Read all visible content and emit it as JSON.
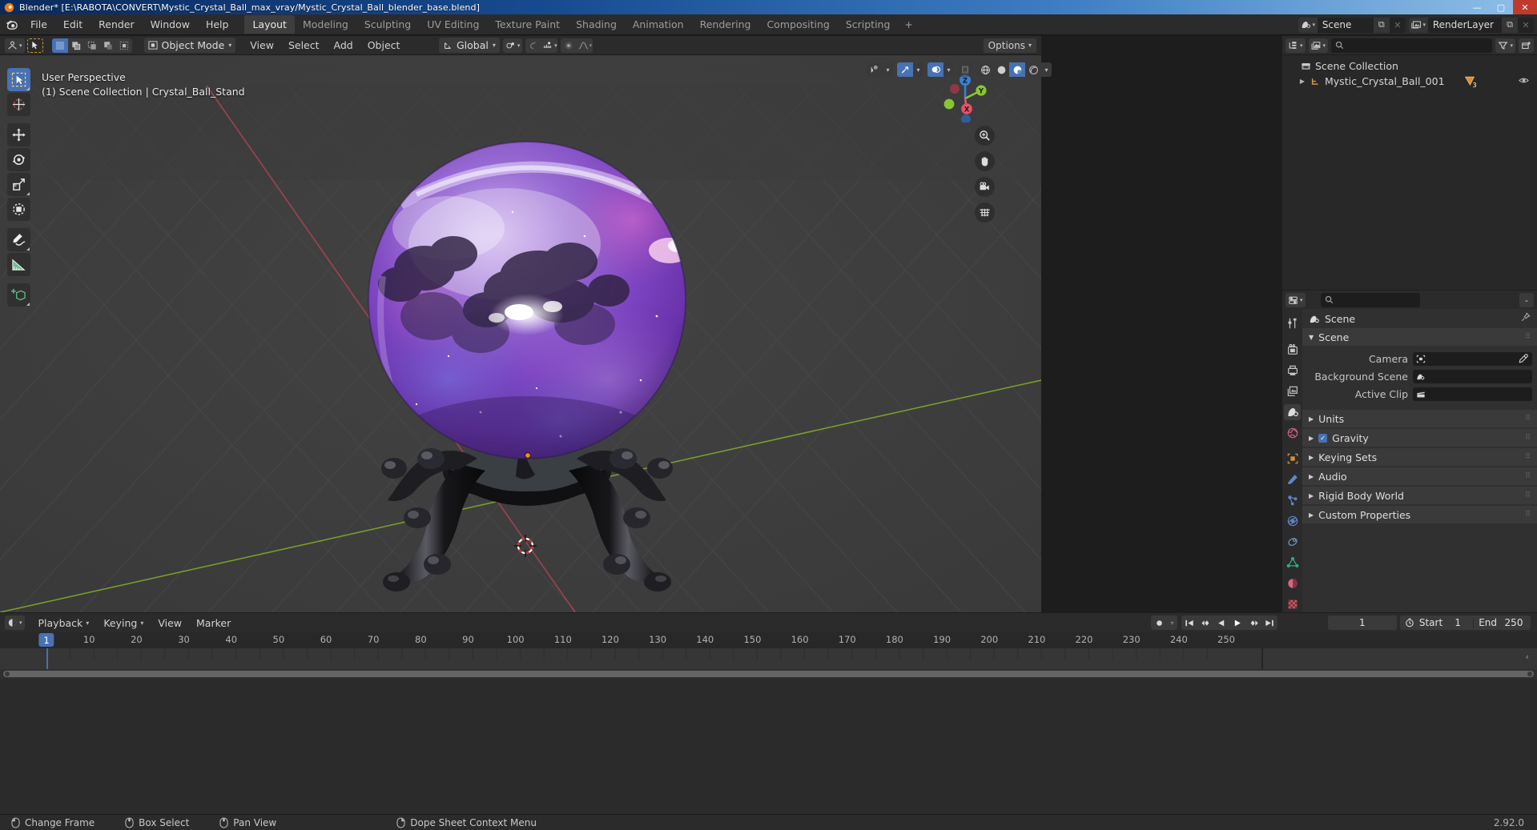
{
  "window": {
    "title": "Blender* [E:\\RABOTA\\CONVERT\\Mystic_Crystal_Ball_max_vray/Mystic_Crystal_Ball_blender_base.blend]",
    "minimize": "—",
    "maximize": "▢",
    "close": "✕"
  },
  "topbar": {
    "menus": [
      "File",
      "Edit",
      "Render",
      "Window",
      "Help"
    ],
    "workspaces": [
      {
        "label": "Layout",
        "active": true
      },
      {
        "label": "Modeling",
        "active": false
      },
      {
        "label": "Sculpting",
        "active": false
      },
      {
        "label": "UV Editing",
        "active": false
      },
      {
        "label": "Texture Paint",
        "active": false
      },
      {
        "label": "Shading",
        "active": false
      },
      {
        "label": "Animation",
        "active": false
      },
      {
        "label": "Rendering",
        "active": false
      },
      {
        "label": "Compositing",
        "active": false
      },
      {
        "label": "Scripting",
        "active": false
      }
    ],
    "add_workspace": "+",
    "scene_name": "Scene",
    "viewlayer_name": "RenderLayer",
    "new_copy": "⧉",
    "unlink": "✕"
  },
  "viewport": {
    "header": {
      "editor_type_icon": "editor-type-3dview",
      "mode": "Object Mode",
      "menus": [
        "View",
        "Select",
        "Add",
        "Object"
      ],
      "select_modes": [
        "set",
        "extend",
        "subtract",
        "invert",
        "intersect"
      ],
      "transform_orientation": "Global",
      "options_label": "Options",
      "shading_modes": [
        "wireframe",
        "solid",
        "material-preview",
        "rendered"
      ],
      "active_shading": "material-preview"
    },
    "overlay_text_line1": "User Perspective",
    "overlay_text_line2": "(1) Scene Collection | Crystal_Ball_Stand",
    "tools": [
      {
        "name": "tweak-tool",
        "active": true
      },
      {
        "name": "cursor-tool",
        "active": false
      },
      {
        "name": "move-tool",
        "active": false
      },
      {
        "name": "rotate-tool",
        "active": false
      },
      {
        "name": "scale-tool",
        "active": false
      },
      {
        "name": "transform-tool",
        "active": false
      },
      {
        "name": "annotate-tool",
        "active": false
      },
      {
        "name": "measure-tool",
        "active": false
      },
      {
        "name": "add-cube-tool",
        "active": false
      }
    ],
    "gizmo_axes": [
      {
        "label": "Z",
        "color": "#3b7fd4"
      },
      {
        "label": "Y",
        "color": "#88c631"
      },
      {
        "label": "X",
        "color": "#e5546a"
      }
    ],
    "nav_buttons": [
      "zoom-icon",
      "hand-icon",
      "camera-icon",
      "grid-icon"
    ],
    "scene_object": "Mystic Crystal Ball on ornate stand",
    "grid_color": "#3b3b3b",
    "axis_x_color": "#c44c56",
    "axis_y_color": "#7fa82b"
  },
  "outliner": {
    "display_mode": "View Layer",
    "search_placeholder": "",
    "filter_icon": "filter-icon",
    "new_collection_icon": "new-collection-icon",
    "rows": [
      {
        "label": "Scene Collection",
        "indent": 0,
        "icon": "collection-icon",
        "expandable": false
      },
      {
        "label": "Mystic_Crystal_Ball_001",
        "indent": 1,
        "icon": "object-icon",
        "expandable": true,
        "badge": "3",
        "visible": true
      }
    ]
  },
  "properties": {
    "search_placeholder": "",
    "tabs": [
      {
        "name": "tool",
        "active": false
      },
      {
        "name": "render",
        "active": false
      },
      {
        "name": "output",
        "active": false
      },
      {
        "name": "view-layer",
        "active": false
      },
      {
        "name": "scene",
        "active": true
      },
      {
        "name": "world",
        "active": false
      },
      {
        "name": "object",
        "active": false
      },
      {
        "name": "modifiers",
        "active": false
      },
      {
        "name": "particles",
        "active": false
      },
      {
        "name": "physics",
        "active": false
      },
      {
        "name": "constraints",
        "active": false
      },
      {
        "name": "data",
        "active": false
      },
      {
        "name": "material",
        "active": false
      },
      {
        "name": "texture",
        "active": false
      }
    ],
    "breadcrumb": "Scene",
    "pin_icon": "pin-icon",
    "panels": [
      {
        "label": "Scene",
        "open": true,
        "checkbox": null
      },
      {
        "label": "Units",
        "open": false,
        "checkbox": null
      },
      {
        "label": "Gravity",
        "open": false,
        "checkbox": true
      },
      {
        "label": "Keying Sets",
        "open": false,
        "checkbox": null
      },
      {
        "label": "Audio",
        "open": false,
        "checkbox": null
      },
      {
        "label": "Rigid Body World",
        "open": false,
        "checkbox": null
      },
      {
        "label": "Custom Properties",
        "open": false,
        "checkbox": null
      }
    ],
    "scene_fields": [
      {
        "label": "Camera",
        "value": "",
        "icon": "camera-icon",
        "eyedropper": true
      },
      {
        "label": "Background Scene",
        "value": "",
        "icon": "scene-icon",
        "eyedropper": false
      },
      {
        "label": "Active Clip",
        "value": "",
        "icon": "clip-icon",
        "eyedropper": false
      }
    ]
  },
  "timeline": {
    "editor_icon": "timeline-icon",
    "menus": [
      "Playback",
      "Keying",
      "View",
      "Marker"
    ],
    "record_icon": "record-icon",
    "playback_buttons": [
      "jump-start",
      "prev-keyframe",
      "play-reverse",
      "play",
      "next-keyframe",
      "jump-end"
    ],
    "current_frame": "1",
    "start_label": "Start",
    "start_value": "1",
    "end_label": "End",
    "end_value": "250",
    "ruler_ticks": [
      10,
      20,
      30,
      40,
      50,
      60,
      70,
      80,
      90,
      100,
      110,
      120,
      130,
      140,
      150,
      160,
      170,
      180,
      190,
      200,
      210,
      220,
      230,
      240,
      250
    ],
    "playhead_frame": "1"
  },
  "statusbar": {
    "items": [
      {
        "icon": "mouse-left-icon",
        "label": "Change Frame"
      },
      {
        "icon": "mouse-middle-icon",
        "label": "Box Select"
      },
      {
        "icon": "mouse-middle-icon",
        "label": "Pan View"
      },
      {
        "icon": "mouse-right-icon",
        "label": "Dope Sheet Context Menu"
      }
    ],
    "version": "2.92.0"
  },
  "colors": {
    "accent": "#4772b3",
    "panel_bg": "#303030",
    "header_bg": "#2b2b2b",
    "viewport_bg": "#3b3b3b",
    "ball_purple": "#8a4fd0",
    "ball_violet": "#6b3fa8",
    "stand_black": "#151515"
  }
}
